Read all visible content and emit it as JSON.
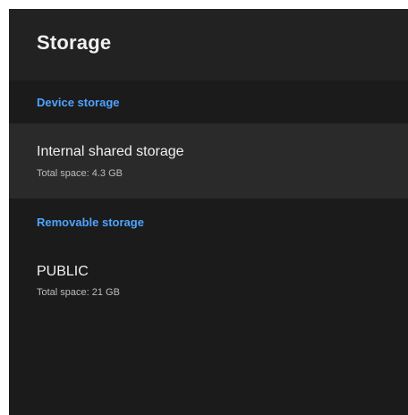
{
  "header": {
    "title": "Storage"
  },
  "sections": {
    "device": {
      "label": "Device storage",
      "items": [
        {
          "title": "Internal shared storage",
          "subtitle": "Total space: 4.3 GB"
        }
      ]
    },
    "removable": {
      "label": "Removable storage",
      "items": [
        {
          "title": "PUBLIC",
          "subtitle": "Total space: 21 GB"
        }
      ]
    }
  },
  "colors": {
    "accent": "#4fa3ff",
    "background": "#1b1b1b",
    "header_background": "#222222",
    "focused_item_background": "#2a2a2a"
  }
}
